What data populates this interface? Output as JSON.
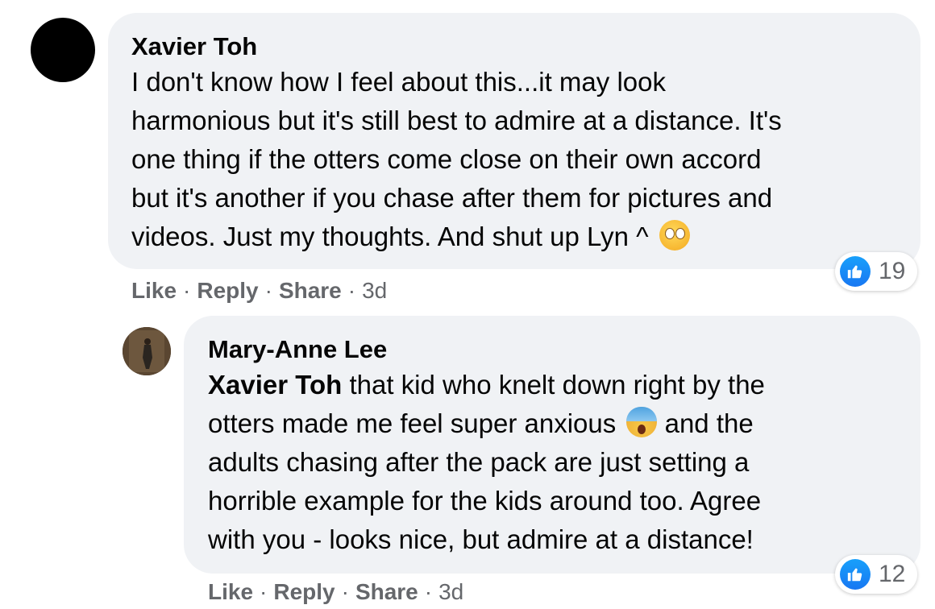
{
  "comments": [
    {
      "author": "Xavier Toh",
      "lines": [
        "I don't know how I feel about this...it may look",
        "harmonious but it's still best to admire at a distance. It's",
        "one thing if the otters come close on their own accord",
        "but it's another if you chase after them for pictures and",
        "videos. Just my thoughts. And shut up Lyn ^"
      ],
      "emoji": "face-with-rolling-eyes",
      "reaction_icon": "like-icon",
      "reaction_count": "19",
      "actions": {
        "like": "Like",
        "reply": "Reply",
        "share": "Share",
        "separator": "·",
        "time": "3d"
      }
    },
    {
      "author": "Mary-Anne Lee",
      "tag": "Xavier Toh",
      "lines": [
        " that kid who knelt down right by the",
        "otters made me feel super anxious ",
        " and the",
        "adults chasing after the pack are just setting a",
        "horrible example for the kids around too. Agree",
        "with you - looks nice, but admire at a distance!"
      ],
      "emoji": "face-screaming-in-fear",
      "reaction_icon": "like-icon",
      "reaction_count": "12",
      "actions": {
        "like": "Like",
        "reply": "Reply",
        "share": "Share",
        "separator": "·",
        "time": "3d"
      }
    }
  ],
  "colors": {
    "bubble": "#f0f2f5",
    "meta_text": "#65676b",
    "like_blue": "#1877f2"
  }
}
